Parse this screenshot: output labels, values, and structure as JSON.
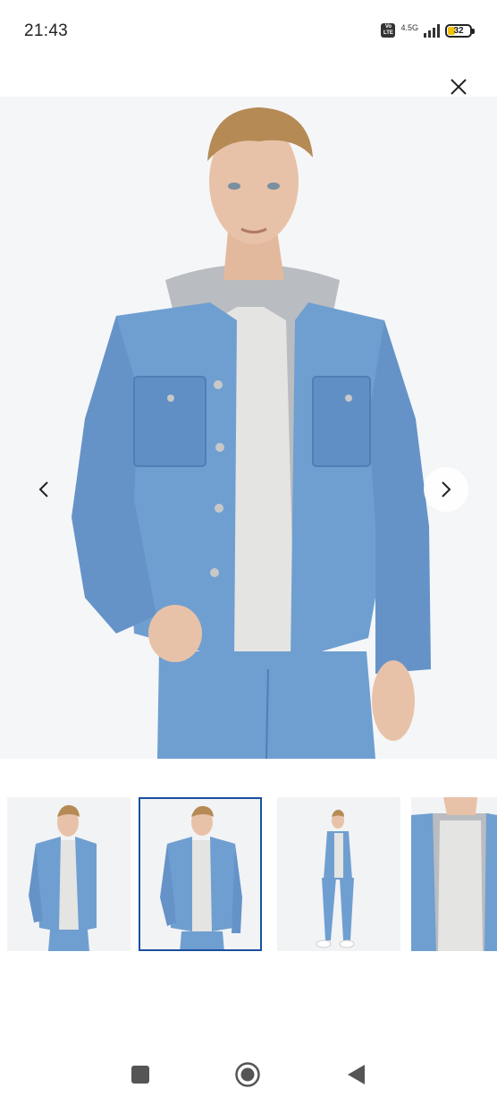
{
  "status_bar": {
    "time": "21:43",
    "volte": [
      "Vo",
      "LTE"
    ],
    "network": "4.5G",
    "battery_level": "32",
    "battery_fraction": 0.32
  },
  "icons": {
    "close": "close-icon",
    "prev": "chevron-left-icon",
    "next": "chevron-right-icon",
    "nav_recents": "square-icon",
    "nav_home": "circle-icon",
    "nav_back": "triangle-back-icon"
  },
  "gallery": {
    "selected_index": 1,
    "thumbnail_count": 4
  },
  "colors": {
    "denim": "#6f9fd0",
    "denim_dark": "#4f7fb5",
    "hoodie": "#b9bcc0",
    "tshirt": "#e4e4e2",
    "skin": "#e8c2a8",
    "hair": "#b58a55",
    "active_border": "#1a4fa0"
  }
}
